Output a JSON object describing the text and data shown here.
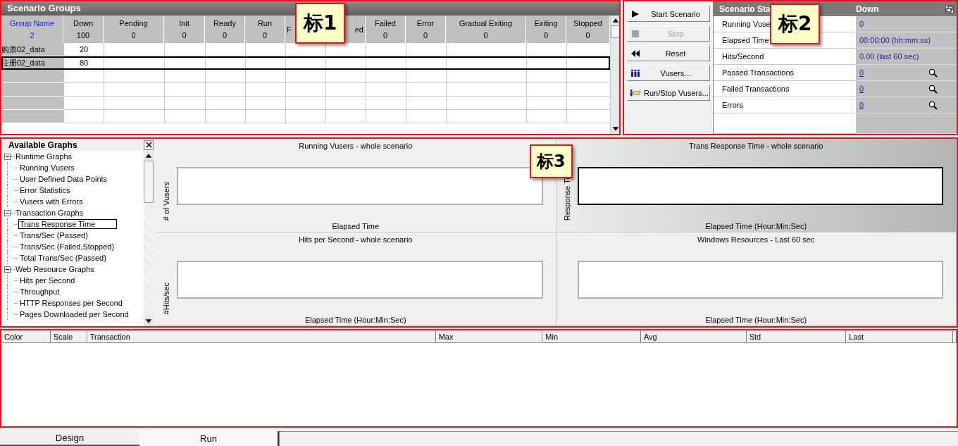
{
  "scenario_groups": {
    "title": "Scenario Groups",
    "columns": [
      {
        "label": "Group Name",
        "count": "2",
        "kind": "name"
      },
      {
        "label": "Down",
        "count": "100"
      },
      {
        "label": "Pending",
        "count": "0"
      },
      {
        "label": "Init",
        "count": "0"
      },
      {
        "label": "Ready",
        "count": "0"
      },
      {
        "label": "Run",
        "count": "0"
      },
      {
        "label": "F"
      },
      {
        "label": "ed"
      },
      {
        "label": "Failed",
        "count": "0"
      },
      {
        "label": "Error",
        "count": "0"
      },
      {
        "label": "Gradual Exiting",
        "count": "0"
      },
      {
        "label": "Exiting",
        "count": "0"
      },
      {
        "label": "Stopped",
        "count": "0"
      }
    ],
    "rows": [
      {
        "name": "购票02_data",
        "down": "20",
        "selected": false
      },
      {
        "name": "注册02_data",
        "down": "80",
        "selected": true
      }
    ]
  },
  "controls": [
    {
      "label": "Start Scenario",
      "kind": "play",
      "disabled": false
    },
    {
      "label": "Stop",
      "kind": "stop",
      "disabled": true
    },
    {
      "label": "Reset",
      "kind": "rewind",
      "disabled": false
    },
    {
      "label": "Vusers...",
      "kind": "people",
      "disabled": false
    },
    {
      "label": "Run/Stop Vusers...",
      "kind": "flag",
      "disabled": false
    }
  ],
  "scenario_status": {
    "title": "Scenario Sta",
    "state": "Down",
    "rows": [
      {
        "label": "Running Vuse",
        "value": "0",
        "kind": "text"
      },
      {
        "label": "Elapsed Time",
        "value": "00:00:00 (hh:mm:ss)",
        "kind": "text"
      },
      {
        "label": "Hits/Second",
        "value": "0.00 (last 60 sec)",
        "kind": "text"
      },
      {
        "label": "Passed Transactions",
        "value": "0",
        "kind": "link"
      },
      {
        "label": "Failed Transactions",
        "value": "0",
        "kind": "link"
      },
      {
        "label": "Errors",
        "value": "0",
        "kind": "link"
      }
    ]
  },
  "available_graphs": {
    "title": "Available Graphs",
    "items": [
      {
        "label": "Runtime Graphs",
        "expanded": true,
        "children": [
          {
            "label": "Running Vusers",
            "selected": false
          },
          {
            "label": "User Defined Data Points",
            "selected": false
          },
          {
            "label": "Error Statistics",
            "selected": false
          },
          {
            "label": "Vusers with Errors",
            "selected": false
          }
        ]
      },
      {
        "label": "Transaction Graphs",
        "expanded": true,
        "children": [
          {
            "label": "Trans Response Time",
            "selected": true
          },
          {
            "label": "Trans/Sec (Passed)",
            "selected": false
          },
          {
            "label": "Trans/Sec (Failed,Stopped)",
            "selected": false
          },
          {
            "label": "Total Trans/Sec (Passed)",
            "selected": false
          }
        ]
      },
      {
        "label": "Web Resource Graphs",
        "expanded": true,
        "children": [
          {
            "label": "Hits per Second",
            "selected": false
          },
          {
            "label": "Throughput",
            "selected": false
          },
          {
            "label": "HTTP Responses per Second",
            "selected": false
          },
          {
            "label": "Pages Downloaded per Second",
            "selected": false
          }
        ]
      }
    ]
  },
  "graphs": [
    {
      "title": "Running Vusers - whole scenario",
      "ylabel": "# of Vusers",
      "xlabel": "Elapsed Time",
      "selected": false
    },
    {
      "title": "Trans Response Time - whole scenario",
      "ylabel": "Response Ti",
      "xlabel": "Elapsed Time (Hour:Min:Sec)",
      "selected": true
    },
    {
      "title": "Hits per Second - whole scenario",
      "ylabel": "#Hits/sec",
      "xlabel": "Elapsed Time (Hour:Min:Sec)",
      "selected": false
    },
    {
      "title": "Windows Resources - Last 60 sec",
      "xlabel": "Elapsed Time (Hour:Min:Sec)",
      "selected": false
    }
  ],
  "measurements": {
    "columns": [
      "Color",
      "Scale",
      "Transaction",
      "Max",
      "Min",
      "Avg",
      "Std",
      "Last"
    ]
  },
  "tabs": [
    {
      "label": "Design",
      "selected": false
    },
    {
      "label": "Run",
      "selected": true
    }
  ],
  "callouts": [
    "标1",
    "标2",
    "标3"
  ]
}
